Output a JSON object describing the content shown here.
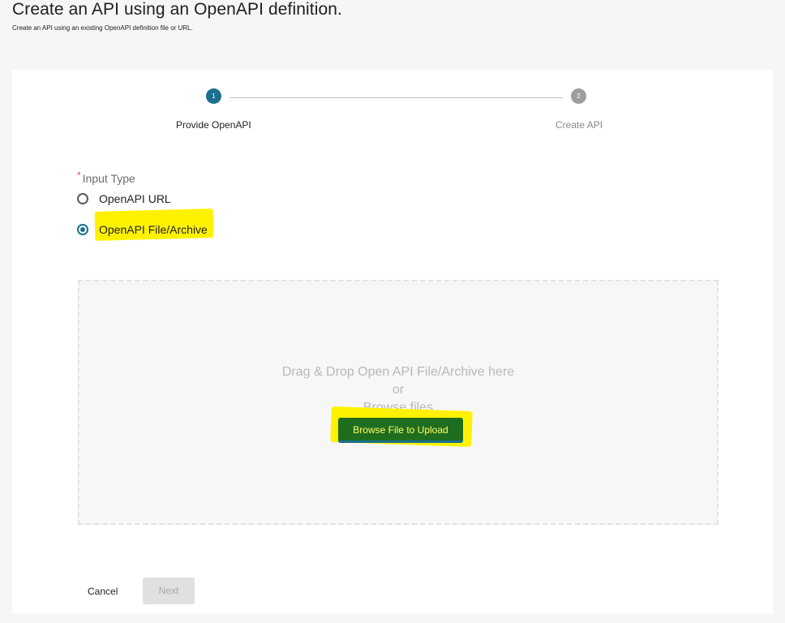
{
  "header": {
    "title": "Create an API using an OpenAPI definition.",
    "subtitle": "Create an API using an existing OpenAPI definition file or URL."
  },
  "stepper": {
    "steps": [
      {
        "number": "1",
        "label": "Provide OpenAPI",
        "status": "active"
      },
      {
        "number": "2",
        "label": "Create API",
        "status": "inactive"
      }
    ]
  },
  "input_type": {
    "required_mark": "*",
    "label": "Input Type",
    "options": [
      {
        "label": "OpenAPI URL",
        "selected": false
      },
      {
        "label": "OpenAPI File/Archive",
        "selected": true
      }
    ]
  },
  "dropzone": {
    "prompt": "Drag & Drop Open API File/Archive here",
    "or": "or",
    "browse_text": "Browse files",
    "button_label": "Browse File to Upload"
  },
  "footer": {
    "cancel_label": "Cancel",
    "next_label": "Next"
  },
  "colors": {
    "accent": "#1b6f8f",
    "highlight": "#fff200",
    "browse_button": "#1f6e1f"
  }
}
